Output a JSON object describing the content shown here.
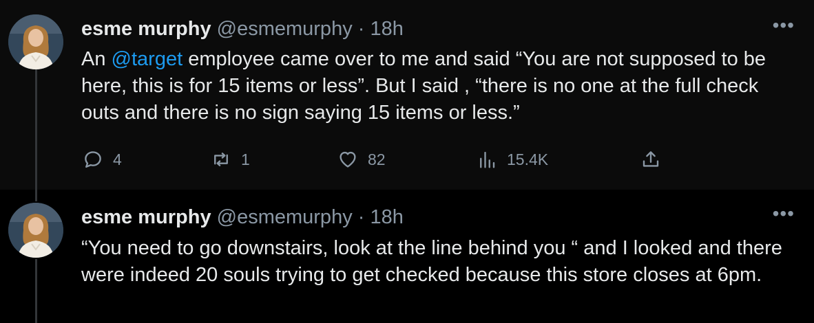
{
  "colors": {
    "background": "#000000",
    "tweet_bg": "#0b0b0b",
    "text": "#e7e9ea",
    "secondary": "#8b98a5",
    "link": "#1d9bf0"
  },
  "tweets": [
    {
      "author": {
        "name": "esme murphy",
        "handle": "@esmemurphy",
        "separator": "·",
        "time": "18h"
      },
      "more_icon": "more-horizontal-icon",
      "text_before": "An ",
      "mention": "@target",
      "text_after": " employee came over to me and said  “You are not supposed to be here,  this is for 15 items or less”. But I said , “there is no one at the full check outs and there is no sign saying 15 items or less.”",
      "actions": {
        "replies": "4",
        "retweets": "1",
        "likes": "82",
        "views": "15.4K"
      }
    },
    {
      "author": {
        "name": "esme murphy",
        "handle": "@esmemurphy",
        "separator": "·",
        "time": "18h"
      },
      "more_icon": "more-horizontal-icon",
      "text": "“You need to go downstairs, look at the line behind you “ and I looked and there were indeed 20 souls trying to get checked because this store closes at 6pm."
    }
  ]
}
